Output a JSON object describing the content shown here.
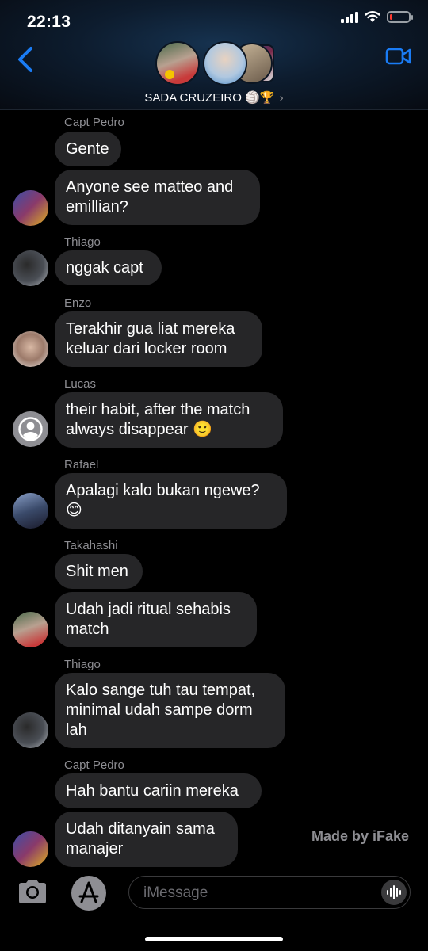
{
  "status_bar": {
    "time": "22:13",
    "battery_level": 0.15
  },
  "header": {
    "group_name": "SADA CRUZEIRO",
    "group_emoji": "🏐🏆",
    "chevron": "›",
    "back_icon": "chevron-left-icon",
    "video_icon": "video-camera-icon"
  },
  "messages": [
    {
      "sender": "Capt Pedro",
      "text": "Gente"
    },
    {
      "sender": "",
      "text": "Anyone see matteo and\nemillian?"
    },
    {
      "sender": "Thiago",
      "text": "nggak capt"
    },
    {
      "sender": "Enzo",
      "text": "Terakhir gua liat mereka\nkeluar dari locker room"
    },
    {
      "sender": "Lucas",
      "text": "their habit, after the match\nalways disappear 🙂"
    },
    {
      "sender": "Rafael",
      "text": "Apalagi kalo bukan ngewe?\n😊"
    },
    {
      "sender": "Takahashi",
      "text": "Shit men"
    },
    {
      "sender": "",
      "text": "Udah jadi ritual sehabis\nmatch"
    },
    {
      "sender": "Thiago",
      "text": "Kalo sange tuh tau tempat,\nminimal udah sampe dorm\nlah"
    },
    {
      "sender": "Capt Pedro",
      "text": "Hah bantu cariin mereka"
    },
    {
      "sender": "",
      "text": "Udah ditanyain sama\nmanajer"
    }
  ],
  "watermark": "Made by iFake",
  "composer": {
    "placeholder": "iMessage"
  },
  "colors": {
    "accent": "#1a7cf5",
    "bubble": "#262628",
    "sender": "#8e8e93"
  }
}
